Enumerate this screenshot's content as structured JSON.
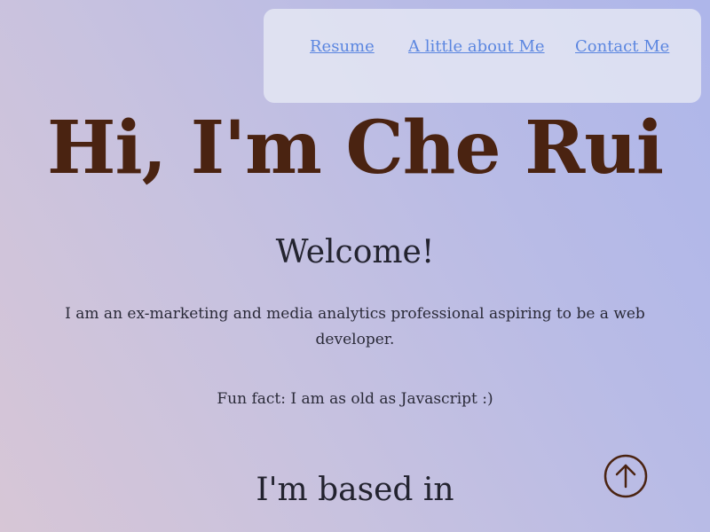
{
  "nav": {
    "links": [
      {
        "label": "Resume"
      },
      {
        "label": "A little about Me"
      },
      {
        "label": "Contact Me"
      }
    ]
  },
  "hero": {
    "title": "Hi, I'm Che Rui"
  },
  "main": {
    "welcome": "Welcome!",
    "intro": "I am an ex-marketing and media analytics professional aspiring to be a web developer.",
    "fun_fact": "Fun fact: I am as old as Javascript :)",
    "based_heading": "I'm based in"
  },
  "icons": {
    "scroll_top": "arrow-up-circle-icon"
  },
  "colors": {
    "link": "#5b86e0",
    "hero_text": "#4a2311",
    "body_text": "#2a2a38",
    "icon": "#4a2311"
  }
}
